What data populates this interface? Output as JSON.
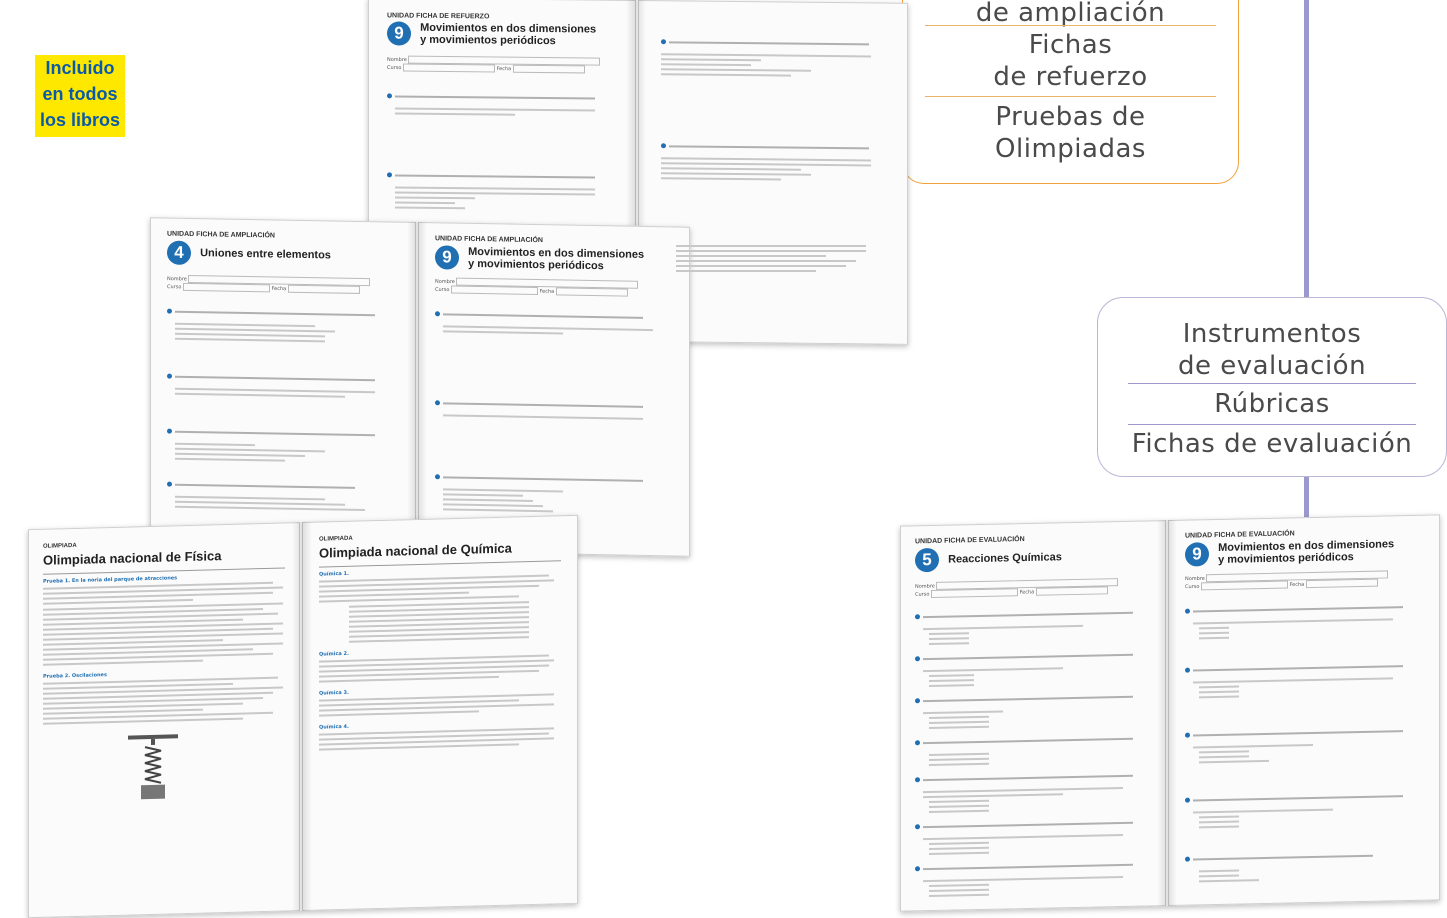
{
  "badge": {
    "line1": "Incluido",
    "line2": "en todos",
    "line3": "los libros"
  },
  "callout_top": {
    "line0": "de ampliación",
    "line1": "Fichas",
    "line2": "de refuerzo",
    "line3": "Pruebas de",
    "line4": "Olimpiadas"
  },
  "callout_right": {
    "line1": "Instrumentos",
    "line2": "de evaluación",
    "line3": "Rúbricas",
    "line4": "Fichas de evaluación"
  },
  "spread_refuerzo": {
    "unit_label": "UNIDAD  FICHA DE REFUERZO",
    "number": "9",
    "title_l1": "Movimientos en dos dimensiones",
    "title_l2": "y movimientos periódicos",
    "nombre": "Nombre",
    "curso": "Curso",
    "fecha": "Fecha"
  },
  "spread_ampliacion": {
    "left": {
      "unit_label": "UNIDAD  FICHA DE AMPLIACIÓN",
      "number": "4",
      "title": "Uniones entre elementos",
      "nombre": "Nombre",
      "curso": "Curso",
      "fecha": "Fecha"
    },
    "right": {
      "unit_label": "UNIDAD  FICHA DE AMPLIACIÓN",
      "number": "9",
      "title_l1": "Movimientos en dos dimensiones",
      "title_l2": "y movimientos periódicos",
      "nombre": "Nombre",
      "curso": "Curso",
      "fecha": "Fecha"
    }
  },
  "spread_olimpiada": {
    "left": {
      "label": "OLIMPIADA",
      "title": "Olimpiada nacional de Física",
      "sec1": "Prueba 1. En la noria del parque de atracciones",
      "sec2": "Prueba 2. Oscilaciones"
    },
    "right": {
      "label": "OLIMPIADA",
      "title": "Olimpiada nacional de Química",
      "sec1": "Química 1.",
      "sec2": "Química 2.",
      "sec3": "Química 3.",
      "sec4": "Química 4."
    }
  },
  "spread_evaluacion": {
    "left": {
      "unit_label": "UNIDAD  FICHA DE EVALUACIÓN",
      "number": "5",
      "title": "Reacciones Químicas",
      "nombre": "Nombre",
      "curso": "Curso",
      "fecha": "Fecha"
    },
    "right": {
      "unit_label": "UNIDAD  FICHA DE EVALUACIÓN",
      "number": "9",
      "title_l1": "Movimientos en dos dimensiones",
      "title_l2": "y movimientos periódicos",
      "nombre": "Nombre",
      "curso": "Curso",
      "fecha": "Fecha"
    }
  },
  "colors": {
    "badge": "#ffe800",
    "badge_text": "#0b5aa8",
    "orange_border": "#f2a23a",
    "blue_border": "#b9b6d6",
    "accent": "#1f6fb2"
  }
}
